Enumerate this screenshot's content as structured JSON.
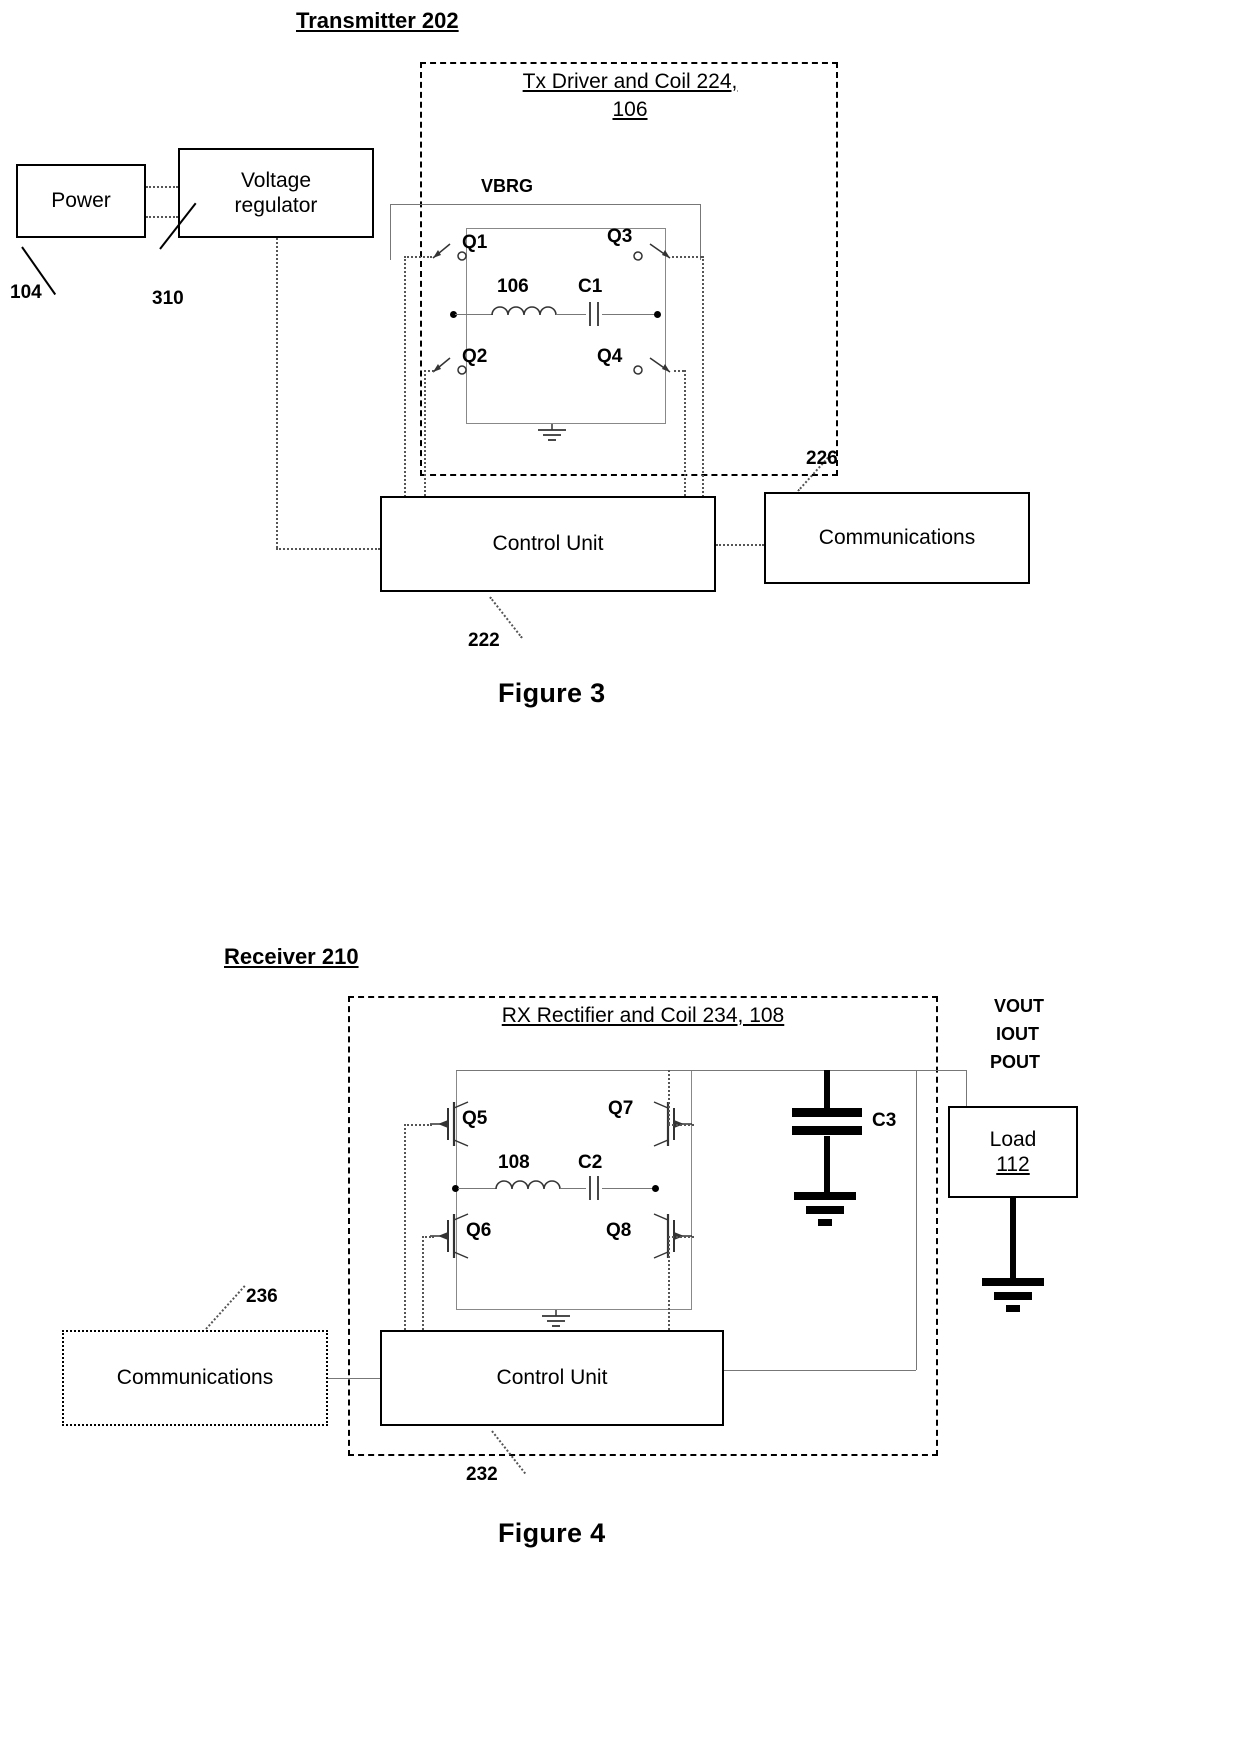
{
  "figure3": {
    "figure_label": "Figure 3",
    "section_title": "Transmitter 202",
    "inner_title_line1": "Tx Driver and Coil 224,",
    "inner_title_line2": "106",
    "power_box": "Power",
    "power_ref": "104",
    "regulator_box_line1": "Voltage",
    "regulator_box_line2": "regulator",
    "regulator_ref": "310",
    "vbrg_label": "VBRG",
    "switches": [
      "Q1",
      "Q3",
      "Q2",
      "Q4"
    ],
    "coil_label": "106",
    "cap_label": "C1",
    "control_unit": "Control Unit",
    "control_unit_ref": "222",
    "communications": "Communications",
    "communications_ref": "226"
  },
  "figure4": {
    "figure_label": "Figure 4",
    "section_title": "Receiver  210",
    "inner_title": "RX Rectifier and Coil 234, 108",
    "switches": [
      "Q5",
      "Q7",
      "Q6",
      "Q8"
    ],
    "coil_label": "108",
    "cap_label": "C2",
    "cap3_label": "C3",
    "output_labels": [
      "VOUT",
      "IOUT",
      "POUT"
    ],
    "load_line1": "Load",
    "load_line2": "112",
    "control_unit": "Control Unit",
    "control_unit_ref": "232",
    "communications": "Communications",
    "communications_ref": "236"
  }
}
